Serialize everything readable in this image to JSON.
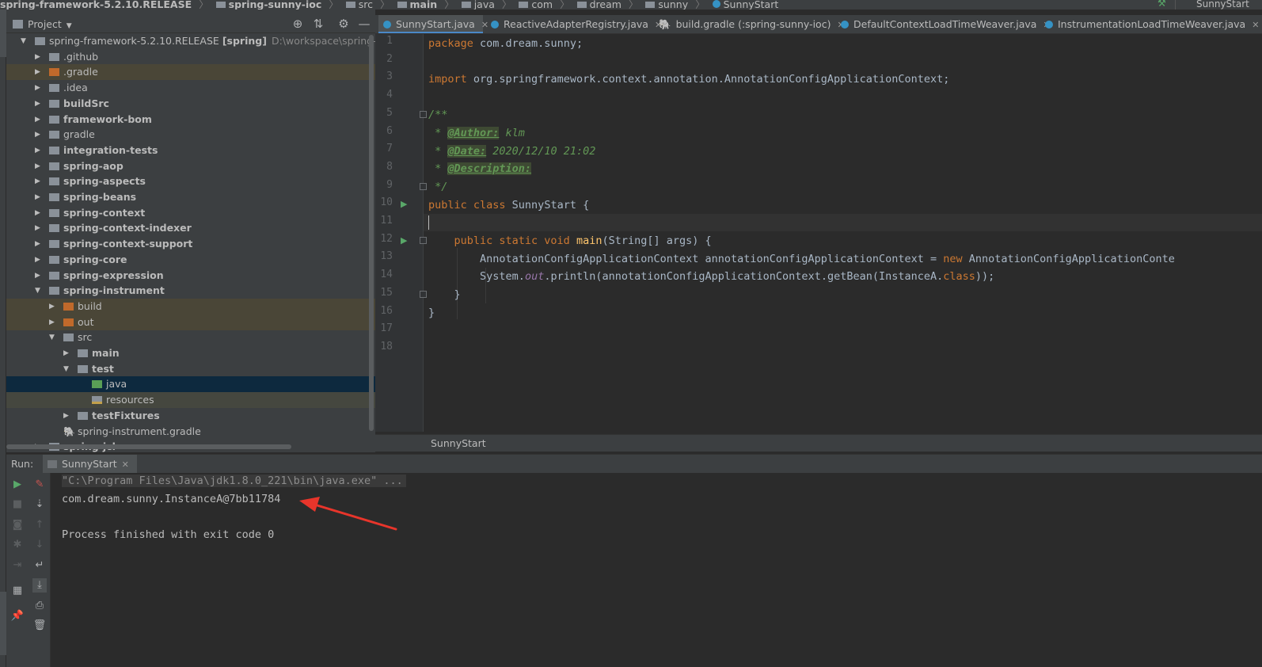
{
  "breadcrumbs": {
    "project": "spring-framework-5.2.10.RELEASE",
    "module": "spring-sunny-ioc",
    "parts": [
      "src",
      "main",
      "java",
      "com",
      "dream",
      "sunny"
    ],
    "class": "SunnyStart",
    "right_label": "SunnyStart"
  },
  "project_panel": {
    "title": "Project",
    "tools": [
      "locate-icon",
      "collapse-icon",
      "gear-icon",
      "minimize-icon"
    ],
    "tree": [
      {
        "label": "spring-framework-5.2.10.RELEASE",
        "tag": "[spring]",
        "path": "D:\\workspace\\spring-framewo",
        "indent": 0,
        "state": "expanded",
        "icon": "gray",
        "bold": false
      },
      {
        "label": ".github",
        "indent": 1,
        "state": "collapsed",
        "icon": "gray",
        "bold": false
      },
      {
        "label": ".gradle",
        "indent": 1,
        "state": "collapsed",
        "icon": "orange",
        "bold": false,
        "highlight": "brown"
      },
      {
        "label": ".idea",
        "indent": 1,
        "state": "collapsed",
        "icon": "gray",
        "bold": false
      },
      {
        "label": "buildSrc",
        "indent": 1,
        "state": "collapsed",
        "icon": "gray",
        "bold": true
      },
      {
        "label": "framework-bom",
        "indent": 1,
        "state": "collapsed",
        "icon": "gray",
        "bold": true
      },
      {
        "label": "gradle",
        "indent": 1,
        "state": "collapsed",
        "icon": "gray",
        "bold": false
      },
      {
        "label": "integration-tests",
        "indent": 1,
        "state": "collapsed",
        "icon": "gray",
        "bold": true
      },
      {
        "label": "spring-aop",
        "indent": 1,
        "state": "collapsed",
        "icon": "gray",
        "bold": true
      },
      {
        "label": "spring-aspects",
        "indent": 1,
        "state": "collapsed",
        "icon": "gray",
        "bold": true
      },
      {
        "label": "spring-beans",
        "indent": 1,
        "state": "collapsed",
        "icon": "gray",
        "bold": true
      },
      {
        "label": "spring-context",
        "indent": 1,
        "state": "collapsed",
        "icon": "gray",
        "bold": true
      },
      {
        "label": "spring-context-indexer",
        "indent": 1,
        "state": "collapsed",
        "icon": "gray",
        "bold": true
      },
      {
        "label": "spring-context-support",
        "indent": 1,
        "state": "collapsed",
        "icon": "gray",
        "bold": true
      },
      {
        "label": "spring-core",
        "indent": 1,
        "state": "collapsed",
        "icon": "gray",
        "bold": true
      },
      {
        "label": "spring-expression",
        "indent": 1,
        "state": "collapsed",
        "icon": "gray",
        "bold": true
      },
      {
        "label": "spring-instrument",
        "indent": 1,
        "state": "expanded",
        "icon": "gray",
        "bold": true
      },
      {
        "label": "build",
        "indent": 2,
        "state": "collapsed",
        "icon": "orange",
        "bold": false,
        "highlight": "brown"
      },
      {
        "label": "out",
        "indent": 2,
        "state": "collapsed",
        "icon": "orange",
        "bold": false,
        "highlight": "brown"
      },
      {
        "label": "src",
        "indent": 2,
        "state": "expanded",
        "icon": "gray",
        "bold": false
      },
      {
        "label": "main",
        "indent": 3,
        "state": "collapsed",
        "icon": "gray",
        "bold": true
      },
      {
        "label": "test",
        "indent": 3,
        "state": "expanded",
        "icon": "gray",
        "bold": true
      },
      {
        "label": "java",
        "indent": 4,
        "state": "none",
        "icon": "green",
        "bold": false,
        "highlight": "blue"
      },
      {
        "label": "resources",
        "indent": 4,
        "state": "none",
        "icon": "res",
        "bold": false,
        "highlight": "gray"
      },
      {
        "label": "testFixtures",
        "indent": 3,
        "state": "collapsed",
        "icon": "gray",
        "bold": true
      },
      {
        "label": "spring-instrument.gradle",
        "indent": 2,
        "state": "none",
        "icon": "gradle",
        "bold": false
      },
      {
        "label": "spring-jcl",
        "indent": 1,
        "state": "collapsed",
        "icon": "gray",
        "bold": true
      }
    ]
  },
  "editor": {
    "tabs": [
      {
        "label": "SunnyStart.java",
        "type": "class",
        "active": true
      },
      {
        "label": "ReactiveAdapterRegistry.java",
        "type": "class",
        "active": false
      },
      {
        "label": "build.gradle (:spring-sunny-ioc)",
        "type": "gradle",
        "active": false
      },
      {
        "label": "DefaultContextLoadTimeWeaver.java",
        "type": "class",
        "active": false
      },
      {
        "label": "InstrumentationLoadTimeWeaver.java",
        "type": "class",
        "active": false
      }
    ],
    "line_numbers": [
      "1",
      "2",
      "3",
      "4",
      "5",
      "6",
      "7",
      "8",
      "9",
      "10",
      "11",
      "12",
      "13",
      "14",
      "15",
      "16",
      "17",
      "18"
    ],
    "code": {
      "l1_kw": "package",
      "l1_rest": " com.dream.sunny;",
      "l3_kw": "import",
      "l3_rest": " org.springframework.context.annotation.AnnotationConfigApplicationContext;",
      "l5": "/**",
      "l6_pre": " * ",
      "l6_tag": "@Author:",
      "l6_val": " klm",
      "l7_pre": " * ",
      "l7_tag": "@Date:",
      "l7_val": " 2020/12/10 21:02",
      "l8_pre": " * ",
      "l8_tag": "@Description:",
      "l9": " */",
      "l10_kw": "public class",
      "l10_rest": " SunnyStart {",
      "l12_kw": "public static void",
      "l12_fn": "main",
      "l12_rest": "(String[] args) {",
      "l13_a": "AnnotationConfigApplicationContext annotationConfigApplicationContext = ",
      "l13_kw": "new",
      "l13_b": " AnnotationConfigApplicationConte",
      "l14_a": "System.",
      "l14_fld": "out",
      "l14_b": ".println(annotationConfigApplicationContext.getBean(InstanceA.",
      "l14_kw": "class",
      "l14_c": "));",
      "l15": "}",
      "l16": "}"
    },
    "breadcrumb": "SunnyStart"
  },
  "run_panel": {
    "label": "Run:",
    "tab": "SunnyStart",
    "console": {
      "line1": "\"C:\\Program Files\\Java\\jdk1.8.0_221\\bin\\java.exe\" ...",
      "line2": "com.dream.sunny.InstanceA@7bb11784",
      "line3": "Process finished with exit code 0"
    },
    "toolbar_left": [
      "run-icon",
      "stop-icon",
      "camera-icon",
      "bug-icon",
      "exit-icon",
      "layout-icon",
      "pin-icon"
    ],
    "toolbar_right": [
      "edit-icon",
      "sort-icon",
      "up-icon",
      "down-icon",
      "wrap-icon",
      "scroll-end-icon",
      "print-icon",
      "trash-icon"
    ]
  },
  "colors": {
    "annotation_arrow": "#e8352b",
    "keyword": "#cc7832",
    "method": "#ffc66d",
    "doc": "#629755",
    "run_green": "#59a869"
  }
}
